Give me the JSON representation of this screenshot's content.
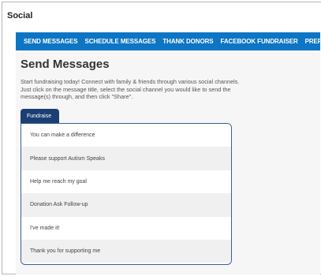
{
  "section": {
    "title": "Social"
  },
  "tabs": [
    {
      "label": "SEND MESSAGES"
    },
    {
      "label": "SCHEDULE MESSAGES"
    },
    {
      "label": "THANK DONORS"
    },
    {
      "label": "FACEBOOK FUNDRAISER"
    },
    {
      "label": "PREFERENCES"
    }
  ],
  "main": {
    "title": "Send Messages",
    "intro": "Start fundraising today! Connect with family & friends through various social channels. Just click on the message title, select the social channel you would like to send the message(s) through, and then click \"Share\".",
    "category_tab": "Fundraise",
    "messages": [
      {
        "title": "You can make a difference"
      },
      {
        "title": "Please support Autism Speaks"
      },
      {
        "title": "Help me reach my goal"
      },
      {
        "title": "Donation Ask Follow-up"
      },
      {
        "title": "I've made it!"
      },
      {
        "title": "Thank you for supporting me"
      }
    ]
  },
  "colors": {
    "tabbar": "#0d75c4",
    "pill": "#1b3f73",
    "list_border": "#3b5f8f"
  }
}
